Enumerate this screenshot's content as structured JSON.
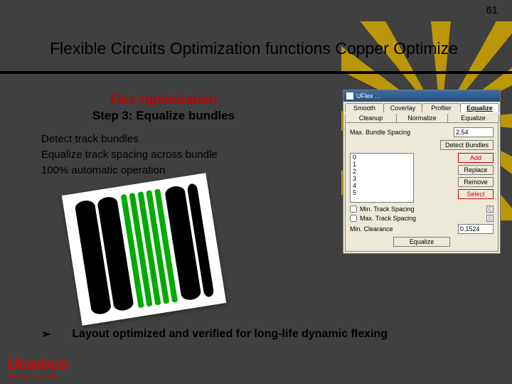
{
  "pageNumber": "61",
  "title": "Flexible Circuits Optimization functions  Copper Optimize",
  "subHeading": {
    "l1": "Flex Optimization",
    "l2": "Step 3: Equalize bundles"
  },
  "body": {
    "line1": "Detect track bundles",
    "line2": "Equalize track spacing across bundle",
    "line3": "100% automatic operation"
  },
  "bullet": {
    "marker": "➢",
    "text": "Layout optimized and verified for long-life dynamic flexing"
  },
  "logo": {
    "name": "Ucamco",
    "tagline": "Because Know Why"
  },
  "dialog": {
    "title": "UFlex …",
    "tabsRow1": [
      "Smooth",
      "Coverlay",
      "Profiler",
      "Equalize"
    ],
    "tabsRow2": [
      "Cleanup",
      "Normalize",
      "Equalize"
    ],
    "activeTab": "Equalize",
    "maxBundleLabel": "Max. Bundle Spacing",
    "maxBundleValue": "2.54",
    "detectBtn": "Detect Bundles",
    "list": [
      "0",
      "1",
      "2",
      "3",
      "4",
      "5"
    ],
    "btns": {
      "add": "Add",
      "replace": "Replace",
      "remove": "Remove",
      "select": "Select"
    },
    "cb1": "Min. Track Spacing",
    "cb1val": "0.1524",
    "cb2": "Max. Track Spacing",
    "cb2val": "0.3048",
    "clearLabel": "Min. Clearance",
    "clearVal": "0.1524",
    "equalizeBtn": "Equalize"
  }
}
